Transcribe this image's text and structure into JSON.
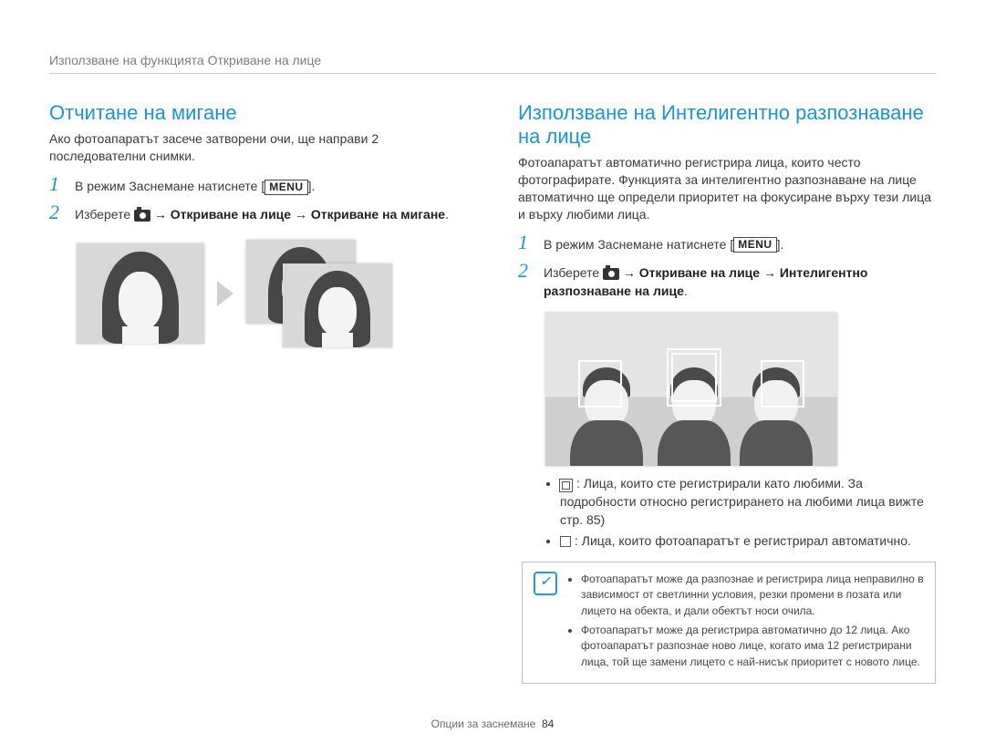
{
  "breadcrumb": "Използване на функцията Откриване на лице",
  "left": {
    "heading": "Отчитане на мигане",
    "intro": "Ако фотоапаратът засече затворени очи, ще направи 2 последователни снимки.",
    "step1_pre": "В режим Заснемане натиснете [",
    "step1_menu": "MENU",
    "step1_post": "].",
    "step2_pre": "Изберете ",
    "step2_bold": " → Откриване на лице → Откриване на мигане",
    "step2_post": "."
  },
  "right": {
    "heading": "Използване на Интелигентно разпознаване на лице",
    "intro": "Фотоапаратът автоматично регистрира лица, които често фотографирате. Функцията за интелигентно разпознаване на лице автоматично ще определи приоритет на фокусиране върху тези лица и върху любими лица.",
    "step1_pre": "В режим Заснемане натиснете [",
    "step1_menu": "MENU",
    "step1_post": "].",
    "step2_pre": "Изберете ",
    "step2_bold": " → Откриване на лице → Интелигентно разпознаване на лице",
    "step2_post": ".",
    "bullet1": ": Лица, които сте регистрирали като любими. За подробности относно регистрирането на любими лица вижте стр. 85)",
    "bullet2": ": Лица, които фотоапаратът е регистрирал автоматично.",
    "note1": "Фотоапаратът може да разпознае и регистрира лица неправилно в зависимост от светлинни условия, резки промени в позата или лицето на обекта, и дали обектът носи очила.",
    "note2": "Фотоапаратът може да регистрира автоматично до 12 лица. Ако фотоапаратът разпознае ново лице, когато има 12 регистрирани лица, той ще замени лицето с най-нисък приоритет с новото лице."
  },
  "footer_label": "Опции за заснемане",
  "page_number": "84"
}
